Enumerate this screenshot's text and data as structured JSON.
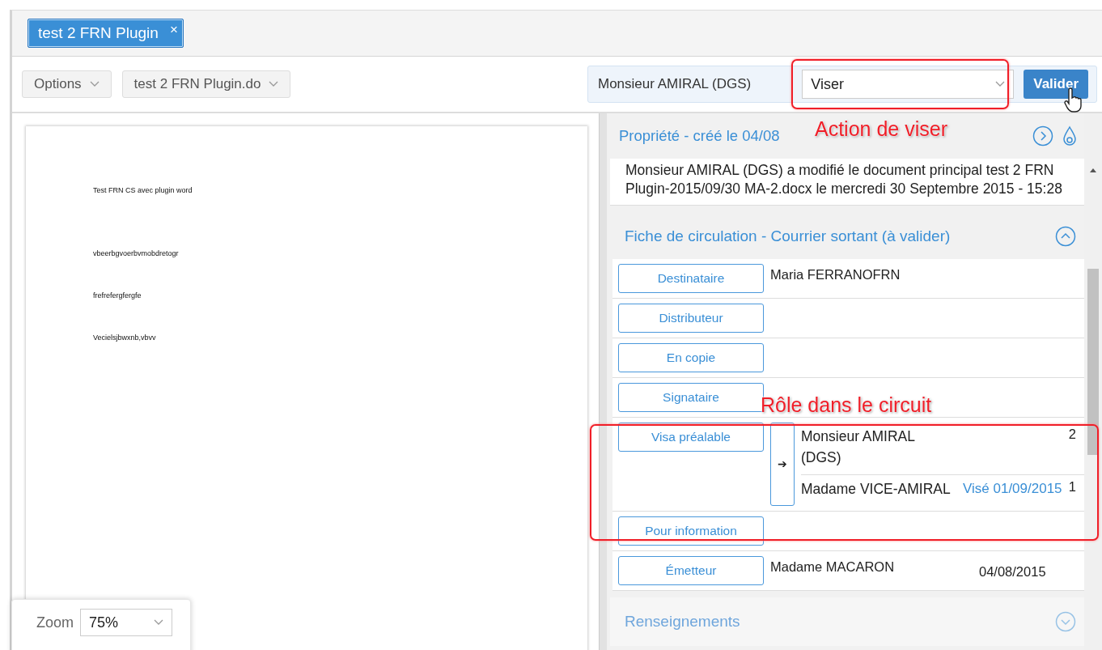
{
  "tab": {
    "label": "test 2 FRN Plugin",
    "close": "×",
    "selected": true
  },
  "toolbar": {
    "options": "Options",
    "document": "test 2 FRN Plugin.do"
  },
  "action": {
    "user": "Monsieur AMIRAL (DGS)",
    "select": "Viser",
    "button": "Valider"
  },
  "document": {
    "lines": [
      "Test FRN CS avec plugin word",
      "vbeerbgvoerbvmobdretogr",
      "frefrefergfergfe",
      "Vecielsjbwxnb,vbvv"
    ]
  },
  "zoom": {
    "label": "Zoom",
    "value": "75%"
  },
  "properties": {
    "title": "Propriété - créé le 04/08",
    "history": "Monsieur AMIRAL (DGS) a modifié le document principal test 2 FRN Plugin-2015/09/30 MA-2.docx le mercredi 30 Septembre 2015 - 15:28"
  },
  "circulation": {
    "title": "Fiche de circulation - Courrier sortant (à valider)",
    "expanded": true,
    "rows": [
      {
        "kind": "single",
        "role": "Destinataire",
        "name": "Maria FERRANOFRN"
      },
      {
        "kind": "single",
        "role": "Distributeur"
      },
      {
        "kind": "single",
        "role": "En copie"
      },
      {
        "kind": "single",
        "role": "Signataire"
      },
      {
        "kind": "chain",
        "role": "Visa préalable",
        "arrow": "➔",
        "steps": [
          {
            "name": "Monsieur AMIRAL (DGS)",
            "order": "2"
          },
          {
            "name": "Madame VICE-AMIRAL",
            "status": "Visé 01/09/2015",
            "order": "1"
          }
        ]
      },
      {
        "kind": "single",
        "role": "Pour information"
      },
      {
        "kind": "single",
        "role": "Émetteur",
        "name": "Madame MACARON",
        "date": "04/08/2015"
      }
    ]
  },
  "renseignements": {
    "title": "Renseignements",
    "expanded": false
  },
  "annotations": [
    {
      "text": "Action de viser"
    },
    {
      "text": "Rôle dans le circuit"
    }
  ]
}
